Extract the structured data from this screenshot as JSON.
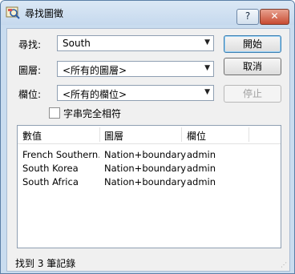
{
  "window": {
    "title": "尋找圖徵",
    "help_label": "?",
    "close_label": "✕"
  },
  "form": {
    "find_label": "尋找:",
    "find_value": "South",
    "layer_label": "圖層:",
    "layer_value": "<所有的圖層>",
    "field_label": "欄位:",
    "field_value": "<所有的欄位>",
    "match_label": "字串完全相符",
    "match_checked": false
  },
  "buttons": {
    "start": "開始",
    "cancel": "取消",
    "stop": "停止"
  },
  "results": {
    "columns": [
      "數值",
      "圖層",
      "欄位"
    ],
    "rows": [
      [
        "French Southern...",
        "Nation+boundary",
        "admin"
      ],
      [
        "South Korea",
        "Nation+boundary",
        "admin"
      ],
      [
        "South Africa",
        "Nation+boundary",
        "admin"
      ]
    ]
  },
  "status": "找到 3 筆記錄"
}
